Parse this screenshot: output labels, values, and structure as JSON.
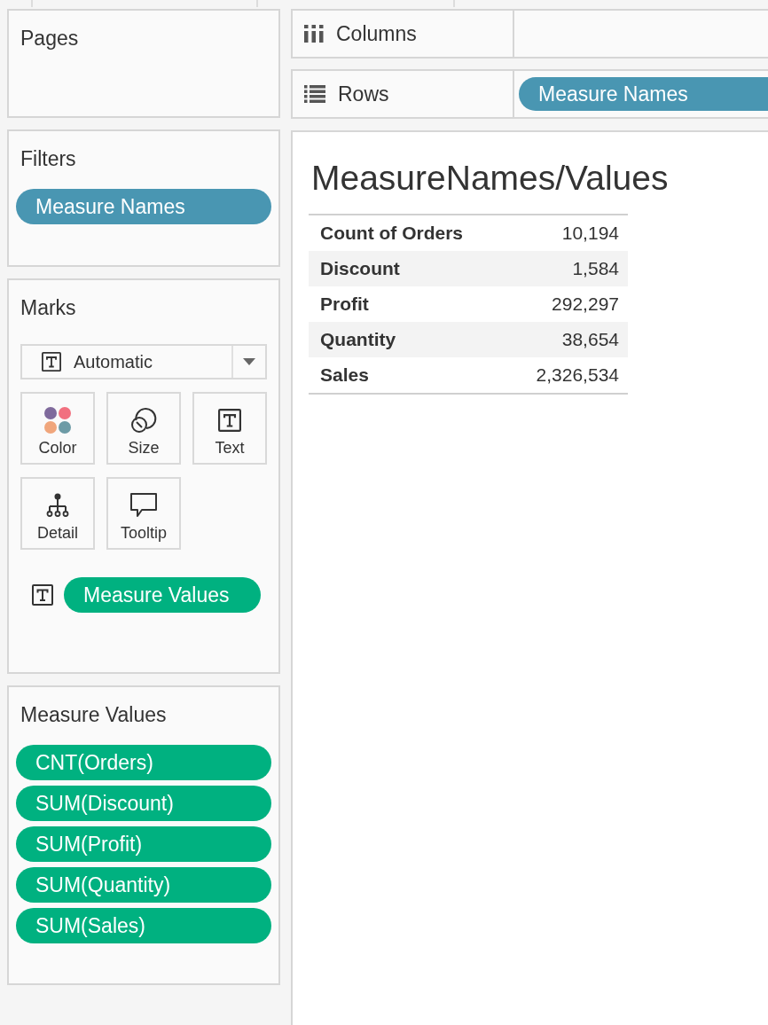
{
  "pages": {
    "title": "Pages"
  },
  "filters": {
    "title": "Filters",
    "pills": [
      {
        "label": "Measure Names",
        "kind": "dimension"
      }
    ]
  },
  "marks": {
    "title": "Marks",
    "mark_type": {
      "value": "Automatic",
      "kind": "text"
    },
    "cards": [
      {
        "label": "Color",
        "kind": "color"
      },
      {
        "label": "Size",
        "kind": "size"
      },
      {
        "label": "Text",
        "kind": "text"
      },
      {
        "label": "Detail",
        "kind": "detail"
      },
      {
        "label": "Tooltip",
        "kind": "tooltip"
      }
    ],
    "encodings": [
      {
        "kind": "text",
        "pill": {
          "label": "Measure Values",
          "kind": "measure"
        }
      }
    ]
  },
  "measure_values": {
    "title": "Measure Values",
    "pills": [
      {
        "label": "CNT(Orders)",
        "kind": "measure"
      },
      {
        "label": "SUM(Discount)",
        "kind": "measure"
      },
      {
        "label": "SUM(Profit)",
        "kind": "measure"
      },
      {
        "label": "SUM(Quantity)",
        "kind": "measure"
      },
      {
        "label": "SUM(Sales)",
        "kind": "measure"
      }
    ]
  },
  "shelves": [
    {
      "kind": "columns",
      "label": "Columns"
    },
    {
      "kind": "rows",
      "label": "Rows",
      "pills": [
        {
          "label": "Measure Names",
          "kind": "dimension"
        }
      ]
    }
  ],
  "view": {
    "title": "MeasureNames/Values",
    "table": {
      "rows": [
        {
          "name": "Count of Orders",
          "value": "10,194"
        },
        {
          "name": "Discount",
          "value": "1,584"
        },
        {
          "name": "Profit",
          "value": "292,297"
        },
        {
          "name": "Quantity",
          "value": "38,654"
        },
        {
          "name": "Sales",
          "value": "2,326,534"
        }
      ]
    }
  }
}
